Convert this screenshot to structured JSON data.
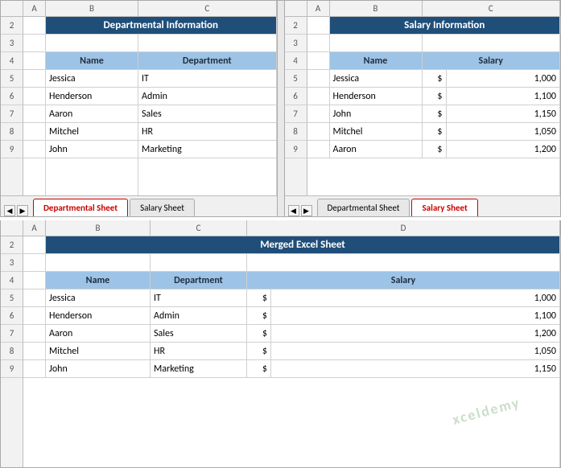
{
  "top_left": {
    "title": "Departmental Information",
    "headers": [
      "Name",
      "Department"
    ],
    "rows": [
      [
        "Jessica",
        "IT"
      ],
      [
        "Henderson",
        "Admin"
      ],
      [
        "Aaron",
        "Sales"
      ],
      [
        "Mitchel",
        "HR"
      ],
      [
        "John",
        "Marketing"
      ]
    ],
    "active_tab": "Departmental Sheet",
    "inactive_tab": "Salary Sheet"
  },
  "top_right": {
    "title": "Salary Information",
    "headers": [
      "Name",
      "Salary"
    ],
    "rows": [
      [
        "Jessica",
        "$",
        "1,000"
      ],
      [
        "Henderson",
        "$",
        "1,100"
      ],
      [
        "John",
        "$",
        "1,150"
      ],
      [
        "Mitchel",
        "$",
        "1,050"
      ],
      [
        "Aaron",
        "$",
        "1,200"
      ]
    ],
    "active_tab": "Salary Sheet",
    "inactive_tab": "Departmental Sheet"
  },
  "bottom": {
    "title": "Merged Excel Sheet",
    "headers": [
      "Name",
      "Department",
      "Salary"
    ],
    "rows": [
      [
        "Jessica",
        "IT",
        "$",
        "1,000"
      ],
      [
        "Henderson",
        "Admin",
        "$",
        "1,100"
      ],
      [
        "Aaron",
        "Sales",
        "$",
        "1,200"
      ],
      [
        "Mitchel",
        "HR",
        "$",
        "1,050"
      ],
      [
        "John",
        "Marketing",
        "$",
        "1,150"
      ]
    ]
  },
  "col_headers_lr": [
    "A",
    "B",
    "C"
  ],
  "col_headers_bottom": [
    "A",
    "B",
    "C",
    "D"
  ],
  "row_numbers": [
    "2",
    "3",
    "4",
    "5",
    "6",
    "7",
    "8",
    "9"
  ],
  "watermark": "xceldemy"
}
